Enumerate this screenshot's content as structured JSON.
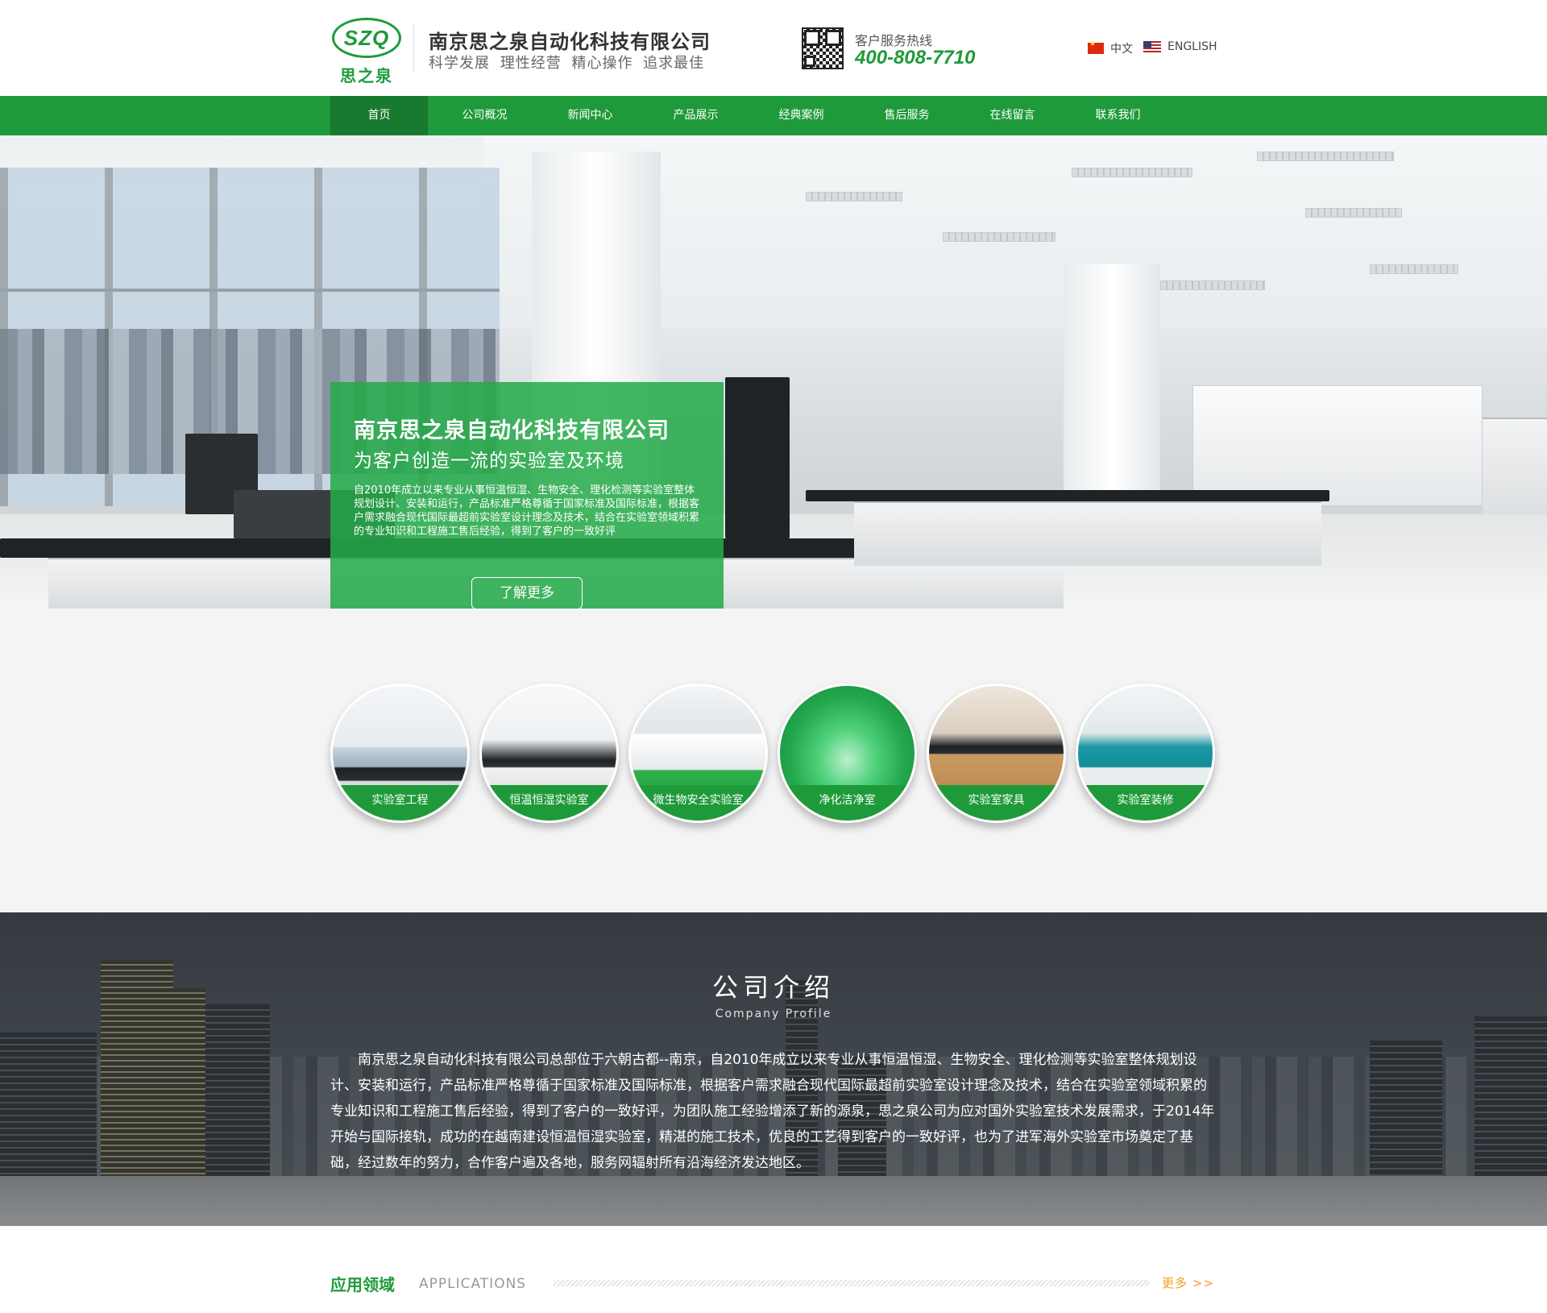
{
  "header": {
    "logo_text": "SZQ",
    "logo_cn": "思之泉",
    "company_name": "南京思之泉自动化科技有限公司",
    "slogan": "科学发展  理性经营  精心操作  追求最佳",
    "hotline_label": "客户服务热线",
    "hotline_number": "400-808-7710",
    "lang_cn": "中文",
    "lang_en": "ENGLISH"
  },
  "nav": {
    "items": [
      {
        "label": "首页",
        "active": true
      },
      {
        "label": "公司概况"
      },
      {
        "label": "新闻中心"
      },
      {
        "label": "产品展示"
      },
      {
        "label": "经典案例"
      },
      {
        "label": "售后服务"
      },
      {
        "label": "在线留言"
      },
      {
        "label": "联系我们"
      }
    ]
  },
  "banner": {
    "title": "南京思之泉自动化科技有限公司",
    "subtitle": "为客户创造一流的实验室及环境",
    "text": "自2010年成立以来专业从事恒温恒湿、生物安全、理化检测等实验室整体规划设计、安装和运行，产品标准严格尊循于国家标准及国际标准，根据客户需求融合现代国际最超前实验室设计理念及技术，结合在实验室领域积累的专业知识和工程施工售后经验，得到了客户的一致好评",
    "button": "了解更多"
  },
  "categories": [
    {
      "label": "实验室工程"
    },
    {
      "label": "恒温恒湿实验室"
    },
    {
      "label": "微生物安全实验室"
    },
    {
      "label": "净化洁净室"
    },
    {
      "label": "实验室家具"
    },
    {
      "label": "实验室装修"
    }
  ],
  "profile": {
    "title": "公司介绍",
    "subtitle": "Company Profile",
    "text": "南京思之泉自动化科技有限公司总部位于六朝古都--南京，自2010年成立以来专业从事恒温恒湿、生物安全、理化检测等实验室整体规划设计、安装和运行，产品标准严格尊循于国家标准及国际标准，根据客户需求融合现代国际最超前实验室设计理念及技术，结合在实验室领域积累的专业知识和工程施工售后经验，得到了客户的一致好评，为团队施工经验增添了新的源泉，思之泉公司为应对国外实验室技术发展需求，于2014年开始与国际接轨，成功的在越南建设恒温恒湿实验室，精湛的施工技术，优良的工艺得到客户的一致好评，也为了进军海外实验室市场奠定了基础，经过数年的努力，合作客户遍及各地，服务网辐射所有沿海经济发达地区。"
  },
  "applications": {
    "title_cn": "应用领域",
    "title_en": "APPLICATIONS",
    "more": "更多 >>"
  },
  "colors": {
    "brand_green": "#1f9a3a",
    "nav_active": "#187a2e",
    "more_orange": "#f0a020"
  }
}
